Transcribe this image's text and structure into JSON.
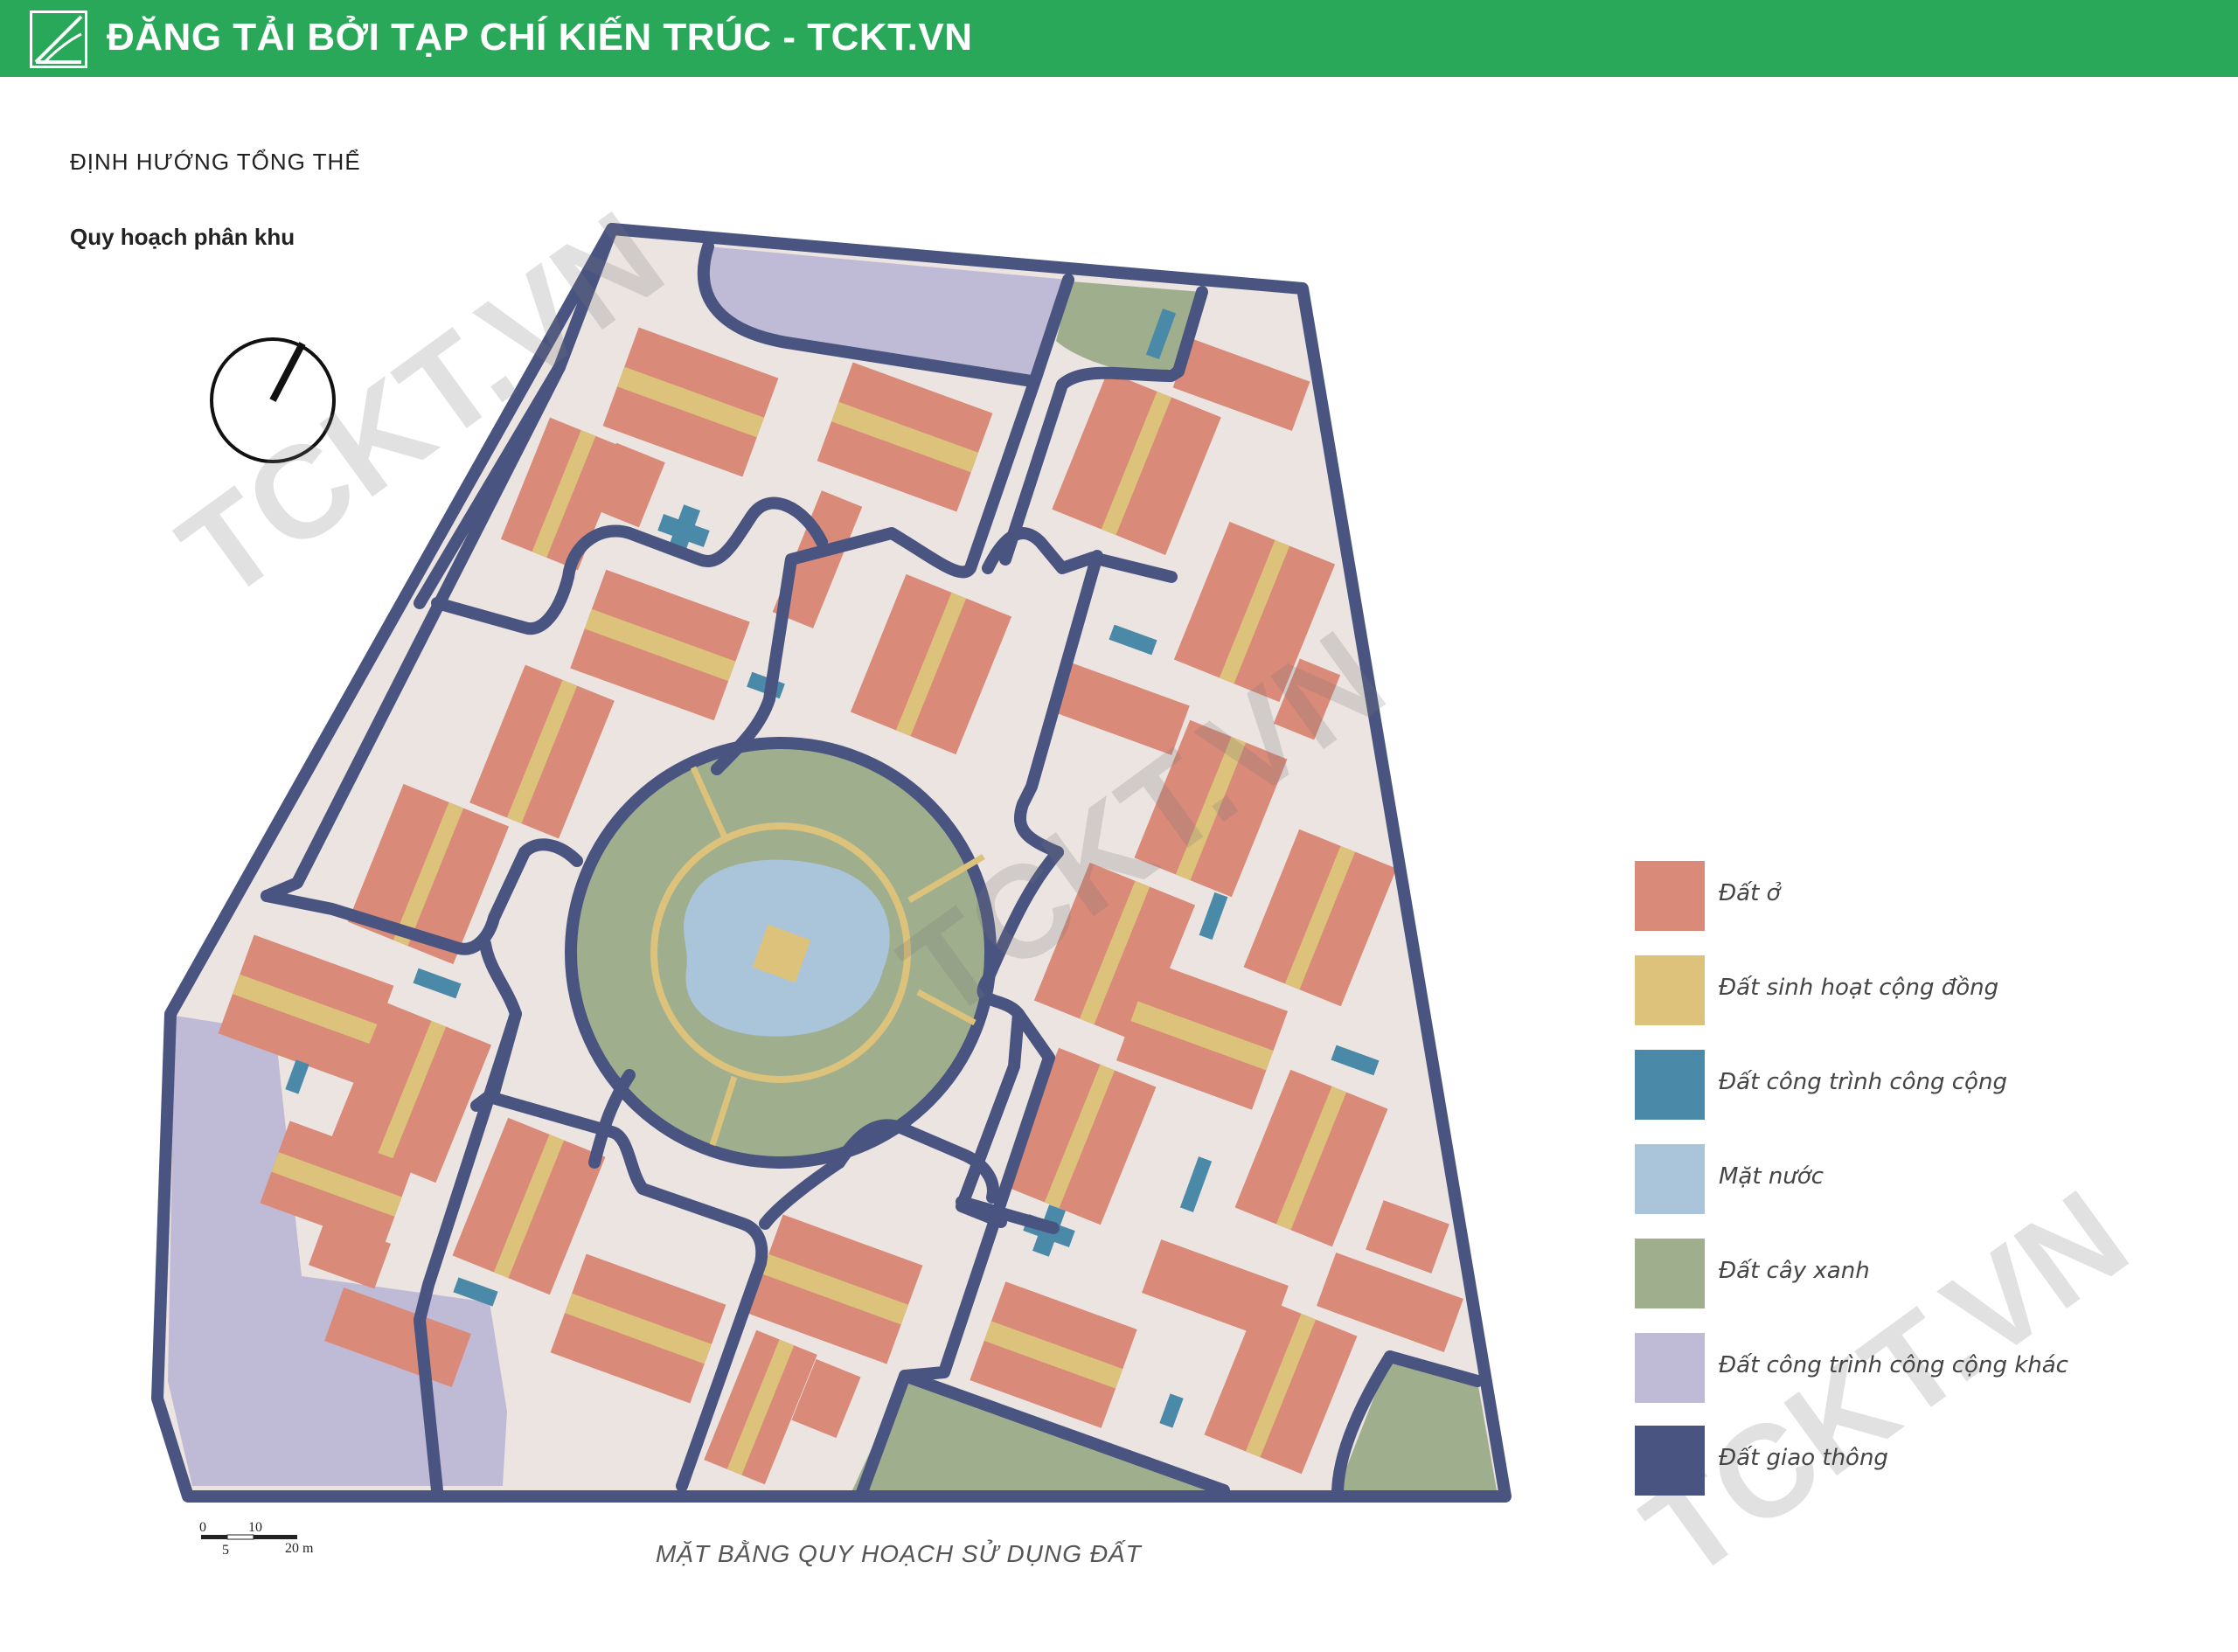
{
  "banner": {
    "title": "ĐĂNG TẢI BỞI TẠP CHÍ KIẾN TRÚC - TCKT.VN",
    "color": "#2aa85a"
  },
  "heading": {
    "title": "ĐỊNH HƯỚNG TỔNG THỂ",
    "subtitle": "Quy hoạch phân khu"
  },
  "caption": "MẶT BẰNG QUY HOẠCH SỬ DỤNG ĐẤT",
  "scale_bar": {
    "ticks": [
      "0",
      "5",
      "10",
      "20 m"
    ]
  },
  "watermark": "TCKT.VN",
  "legend": [
    {
      "label": "Đất ở",
      "color": "#d98a78"
    },
    {
      "label": "Đất sinh hoạt cộng đồng",
      "color": "#dcc27a"
    },
    {
      "label": "Đất công trình công cộng",
      "color": "#4a8aa8"
    },
    {
      "label": "Mặt nước",
      "color": "#aac4da"
    },
    {
      "label": "Đất cây xanh",
      "color": "#9faf8e"
    },
    {
      "label": "Đất công trình công cộng khác",
      "color": "#bfbad6"
    },
    {
      "label": "Đất giao thông",
      "color": "#4a5480"
    }
  ],
  "colors": {
    "site_background": "#ebe4e1",
    "road": "#4a5480"
  }
}
